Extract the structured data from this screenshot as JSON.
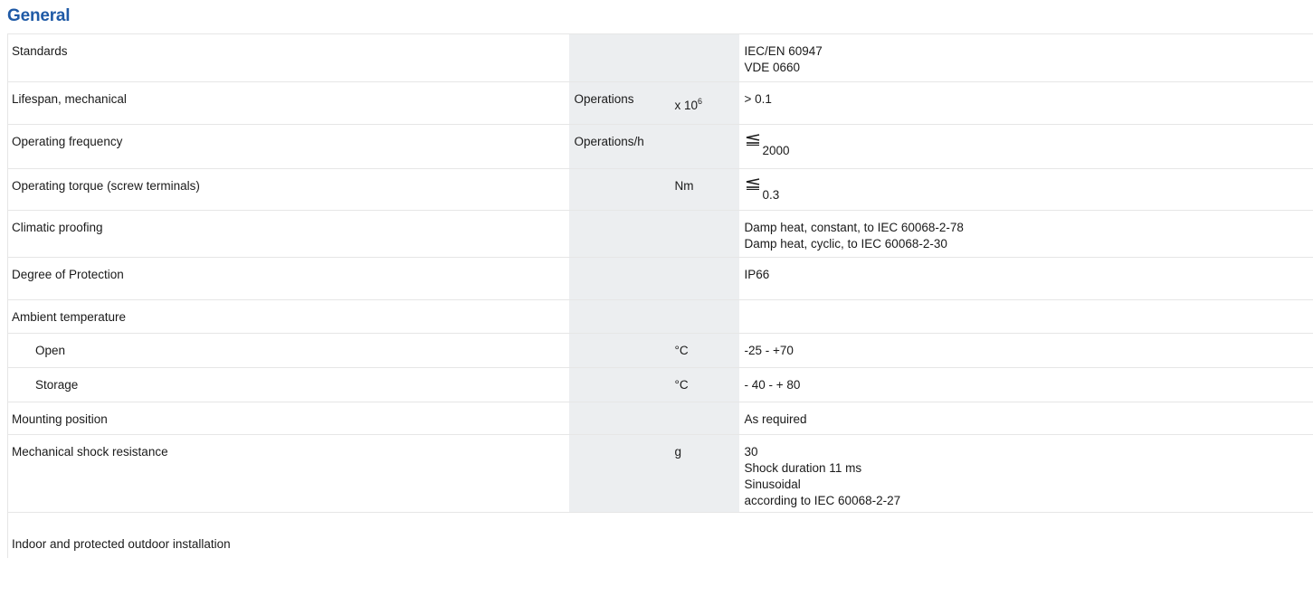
{
  "section": {
    "title": "General"
  },
  "rows": [
    {
      "label": "Standards",
      "unit": "",
      "multiplier": "",
      "values": [
        "IEC/EN 60947",
        "VDE 0660"
      ]
    },
    {
      "label": "Lifespan, mechanical",
      "unit": "Operations",
      "multiplier": "x 10",
      "multiplier_exp": "6",
      "values": [
        "> 0.1"
      ]
    },
    {
      "label": "Operating frequency",
      "unit": "Operations/h",
      "multiplier": "",
      "value_icon": "less-than-or-equal-icon",
      "values": [
        "2000"
      ]
    },
    {
      "label": "Operating torque (screw terminals)",
      "unit": "",
      "multiplier": "Nm",
      "value_icon": "less-than-or-equal-icon",
      "values": [
        "0.3"
      ]
    },
    {
      "label": "Climatic proofing",
      "unit": "",
      "multiplier": "",
      "values": [
        "Damp heat, constant, to IEC 60068-2-78",
        "Damp heat, cyclic, to IEC 60068-2-30"
      ]
    },
    {
      "label": "Degree of Protection",
      "unit": "",
      "multiplier": "",
      "values": [
        "IP66"
      ]
    },
    {
      "label": "Ambient temperature",
      "unit": "",
      "multiplier": "",
      "values": []
    },
    {
      "label": "Open",
      "indent": true,
      "unit": "",
      "multiplier": "°C",
      "values": [
        "-25 - +70"
      ]
    },
    {
      "label": "Storage",
      "indent": true,
      "unit": "",
      "multiplier": "°C",
      "values": [
        "- 40 - + 80"
      ]
    },
    {
      "label": "Mounting position",
      "unit": "",
      "multiplier": "",
      "values": [
        "As required"
      ]
    },
    {
      "label": "Mechanical shock resistance",
      "unit": "",
      "multiplier": "g",
      "values": [
        "30",
        "Shock duration 11 ms",
        "Sinusoidal",
        "according to IEC 60068-2-27"
      ]
    }
  ],
  "footer": {
    "text": "Indoor and protected outdoor installation"
  }
}
